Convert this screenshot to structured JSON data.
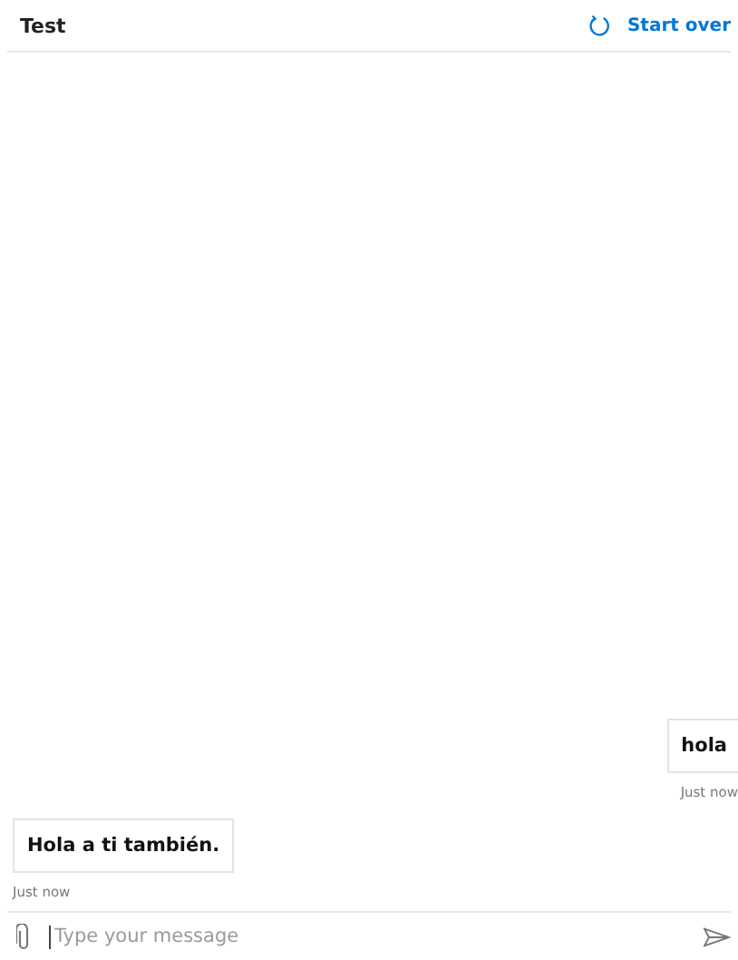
{
  "header": {
    "title": "Test",
    "start_over": "Start over"
  },
  "messages": [
    {
      "kind": "user",
      "text": "hola",
      "time": "Just now"
    },
    {
      "kind": "bot",
      "text": "Hola a ti también.",
      "time": "Just now"
    }
  ],
  "composer": {
    "placeholder": "Type your message"
  }
}
